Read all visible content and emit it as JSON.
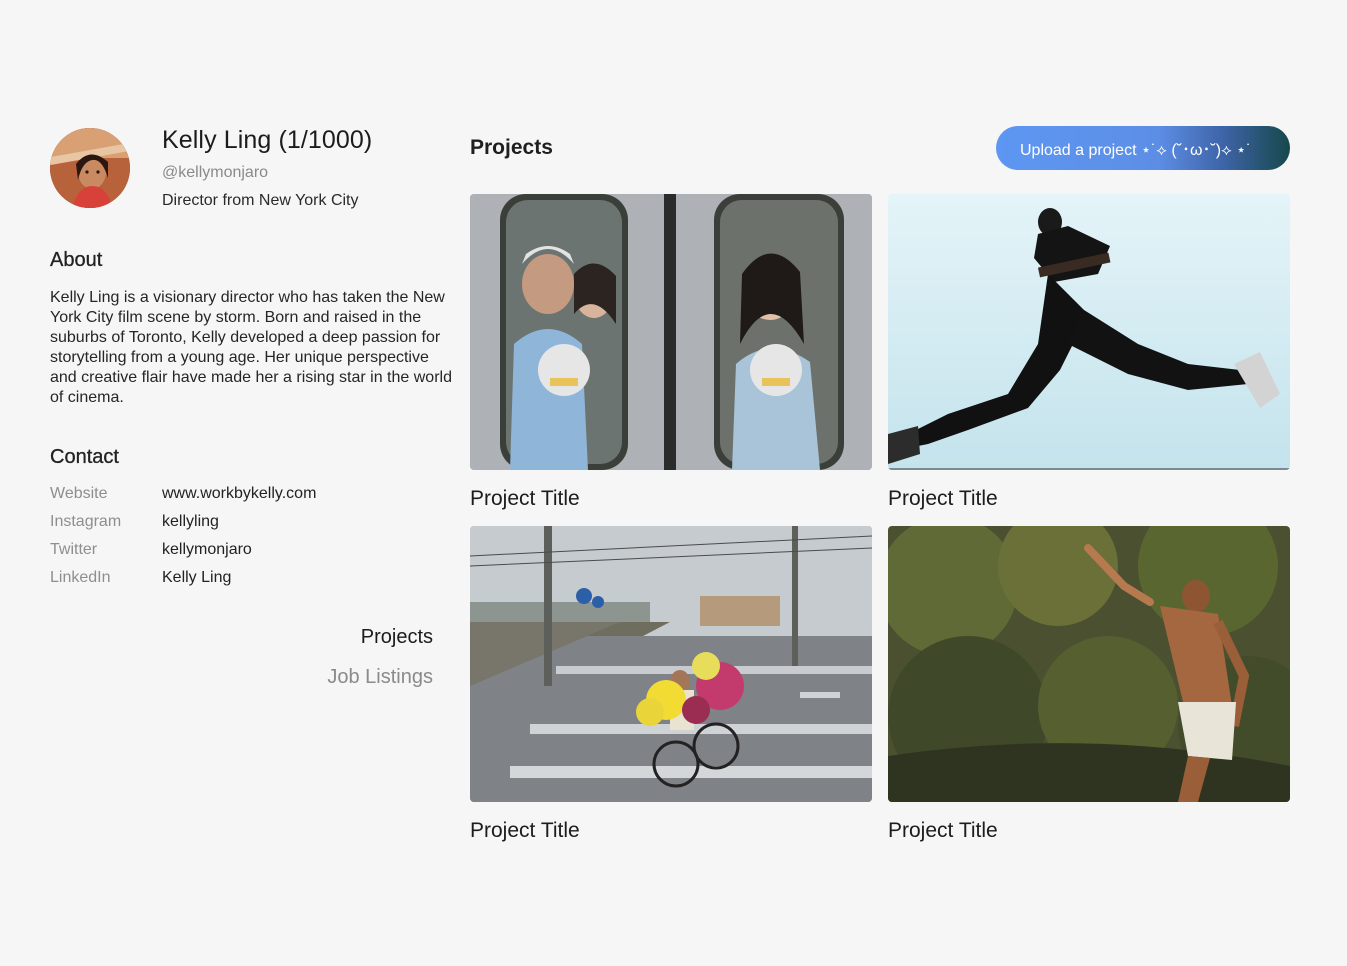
{
  "profile": {
    "name": "Kelly Ling (1/1000)",
    "handle": "@kellymonjaro",
    "tagline": "Director from New York City"
  },
  "about": {
    "title": "About",
    "text": "Kelly Ling is a visionary director who has taken the New York City film scene by storm. Born and raised in the suburbs of Toronto, Kelly developed a deep passion for storytelling from a young age. Her unique perspective and creative flair have made her a rising star in the world of cinema."
  },
  "contact": {
    "title": "Contact",
    "rows": [
      {
        "label": "Website",
        "value": "www.workbykelly.com"
      },
      {
        "label": "Instagram",
        "value": "kellyling"
      },
      {
        "label": "Twitter",
        "value": "kellymonjaro"
      },
      {
        "label": "LinkedIn",
        "value": "Kelly Ling"
      }
    ]
  },
  "nav": {
    "projects": "Projects",
    "jobs": "Job Listings"
  },
  "projects": {
    "heading": "Projects",
    "upload_label": "Upload a project ⋆˙⟡ (˘･ω･˘)⟡ ⋆˙",
    "items": [
      {
        "title": "Project Title"
      },
      {
        "title": "Project Title"
      },
      {
        "title": "Project Title"
      },
      {
        "title": "Project Title"
      }
    ]
  },
  "colors": {
    "background": "#f6f6f6",
    "button_gradient_start": "#5d97f2",
    "button_gradient_end": "#17484b"
  }
}
